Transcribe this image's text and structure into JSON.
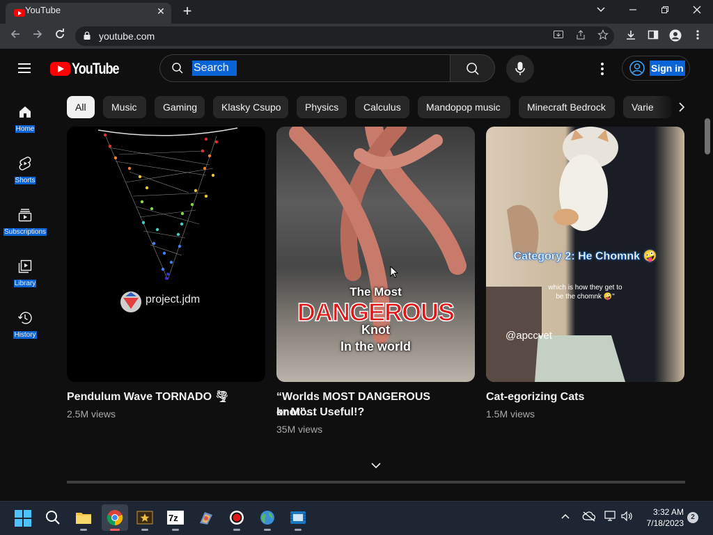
{
  "browser": {
    "tab_title": "YouTube",
    "url": "youtube.com"
  },
  "header": {
    "logo_text": "YouTube",
    "search_placeholder": "Search",
    "signin_label": "Sign in"
  },
  "sidebar": {
    "items": [
      {
        "label": "Home",
        "icon": "home-icon"
      },
      {
        "label": "Shorts",
        "icon": "shorts-icon"
      },
      {
        "label": "Subscriptions",
        "icon": "subscriptions-icon"
      },
      {
        "label": "Library",
        "icon": "library-icon"
      },
      {
        "label": "History",
        "icon": "history-icon"
      }
    ]
  },
  "chips": [
    "All",
    "Music",
    "Gaming",
    "Klasky Csupo",
    "Physics",
    "Calculus",
    "Mandopop music",
    "Minecraft Bedrock",
    "Varie"
  ],
  "videos": [
    {
      "title": "Pendulum Wave TORNADO 🌪",
      "views": "2.5M views",
      "thumb_channel": "project.jdm"
    },
    {
      "title_line1": "“Worlds MOST DANGEROUS knot”…",
      "title_line2": "or Most Useful!?",
      "views": "35M views",
      "thumb_line1": "The Most",
      "thumb_line2": "DANGEROUS",
      "thumb_line3": "Knot",
      "thumb_line4": "In the world"
    },
    {
      "title": "Cat-egorizing Cats",
      "views": "1.5M views",
      "thumb_caption": "Category 2: He Chomnk 🤪",
      "thumb_subcaption_1": "which is how they get to",
      "thumb_subcaption_2": "be the chomnk 🤪\"",
      "thumb_handle": "@apccvet"
    }
  ],
  "taskbar": {
    "time": "3:32 AM",
    "date": "7/18/2023",
    "notifications": "2"
  },
  "colors": {
    "background": "#0f0f0f",
    "brand_red": "#ff0000",
    "selection_blue": "#0a64d8",
    "chip_bg": "#272727"
  }
}
